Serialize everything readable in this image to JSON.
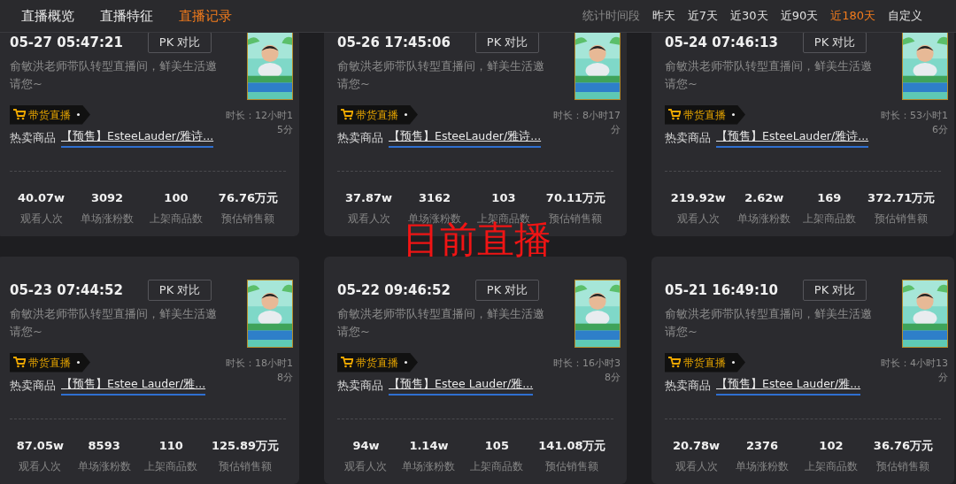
{
  "tabs": [
    {
      "label": "直播概览",
      "selected": false
    },
    {
      "label": "直播特征",
      "selected": false
    },
    {
      "label": "直播记录",
      "selected": true
    }
  ],
  "time_filter": {
    "label": "统计时间段",
    "options": [
      {
        "label": "昨天",
        "selected": false
      },
      {
        "label": "近7天",
        "selected": false
      },
      {
        "label": "近30天",
        "selected": false
      },
      {
        "label": "近90天",
        "selected": false
      },
      {
        "label": "近180天",
        "selected": true
      },
      {
        "label": "自定义",
        "selected": false
      }
    ]
  },
  "records": [
    {
      "date": "05-27 05:47:21",
      "pk_button": "PK 对比",
      "description": "俞敏洪老师带队转型直播间，鲜美生活邀请您~",
      "badge": "带货直播",
      "duration": "时长：12小时15分",
      "hot_label": "热卖商品",
      "hot_product": "【预售】EsteeLauder/雅诗...",
      "stats": [
        {
          "value": "40.07w",
          "label": "观看人次"
        },
        {
          "value": "3092",
          "label": "单场涨粉数"
        },
        {
          "value": "100",
          "label": "上架商品数"
        },
        {
          "value": "76.76万元",
          "label": "预估销售额"
        }
      ]
    },
    {
      "date": "05-26 17:45:06",
      "pk_button": "PK 对比",
      "description": "俞敏洪老师带队转型直播间，鲜美生活邀请您~",
      "badge": "带货直播",
      "duration": "时长：8小时17分",
      "hot_label": "热卖商品",
      "hot_product": "【预售】EsteeLauder/雅诗...",
      "stats": [
        {
          "value": "37.87w",
          "label": "观看人次"
        },
        {
          "value": "3162",
          "label": "单场涨粉数"
        },
        {
          "value": "103",
          "label": "上架商品数"
        },
        {
          "value": "70.11万元",
          "label": "预估销售额"
        }
      ]
    },
    {
      "date": "05-24 07:46:13",
      "pk_button": "PK 对比",
      "description": "俞敏洪老师带队转型直播间，鲜美生活邀请您~",
      "badge": "带货直播",
      "duration": "时长：53小时16分",
      "hot_label": "热卖商品",
      "hot_product": "【预售】EsteeLauder/雅诗...",
      "stats": [
        {
          "value": "219.92w",
          "label": "观看人次"
        },
        {
          "value": "2.62w",
          "label": "单场涨粉数"
        },
        {
          "value": "169",
          "label": "上架商品数"
        },
        {
          "value": "372.71万元",
          "label": "预估销售额"
        }
      ]
    },
    {
      "date": "05-23 07:44:52",
      "pk_button": "PK 对比",
      "description": "俞敏洪老师带队转型直播间，鲜美生活邀请您~",
      "badge": "带货直播",
      "duration": "时长：18小时18分",
      "hot_label": "热卖商品",
      "hot_product": "【预售】Estee Lauder/雅...",
      "stats": [
        {
          "value": "87.05w",
          "label": "观看人次"
        },
        {
          "value": "8593",
          "label": "单场涨粉数"
        },
        {
          "value": "110",
          "label": "上架商品数"
        },
        {
          "value": "125.89万元",
          "label": "预估销售额"
        }
      ]
    },
    {
      "date": "05-22 09:46:52",
      "pk_button": "PK 对比",
      "description": "俞敏洪老师带队转型直播间，鲜美生活邀请您~",
      "badge": "带货直播",
      "duration": "时长：16小时38分",
      "hot_label": "热卖商品",
      "hot_product": "【预售】Estee Lauder/雅...",
      "stats": [
        {
          "value": "94w",
          "label": "观看人次"
        },
        {
          "value": "1.14w",
          "label": "单场涨粉数"
        },
        {
          "value": "105",
          "label": "上架商品数"
        },
        {
          "value": "141.08万元",
          "label": "预估销售额"
        }
      ]
    },
    {
      "date": "05-21 16:49:10",
      "pk_button": "PK 对比",
      "description": "俞敏洪老师带队转型直播间，鲜美生活邀请您~",
      "badge": "带货直播",
      "duration": "时长：4小时13分",
      "hot_label": "热卖商品",
      "hot_product": "【预售】Estee Lauder/雅...",
      "stats": [
        {
          "value": "20.78w",
          "label": "观看人次"
        },
        {
          "value": "2376",
          "label": "单场涨粉数"
        },
        {
          "value": "102",
          "label": "上架商品数"
        },
        {
          "value": "36.76万元",
          "label": "预估销售额"
        }
      ]
    }
  ],
  "annotation": "目前直播"
}
